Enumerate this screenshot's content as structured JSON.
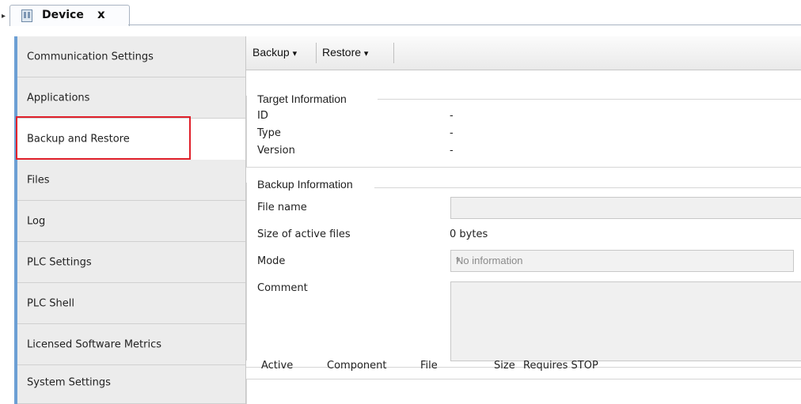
{
  "tab": {
    "title": "Device",
    "close": "x",
    "icon": "device-icon"
  },
  "sidebar": {
    "items": [
      {
        "label": "Communication Settings"
      },
      {
        "label": "Applications"
      },
      {
        "label": "Backup and Restore",
        "selected": true
      },
      {
        "label": "Files"
      },
      {
        "label": "Log"
      },
      {
        "label": "PLC Settings"
      },
      {
        "label": "PLC Shell"
      },
      {
        "label": "Licensed Software Metrics"
      },
      {
        "label": "System Settings"
      }
    ]
  },
  "toolbar": {
    "backup_label": "Backup",
    "restore_label": "Restore",
    "dropdown_glyph": "▾"
  },
  "target_info": {
    "title": "Target Information",
    "id_label": "ID",
    "id_value": "-",
    "type_label": "Type",
    "type_value": "-",
    "version_label": "Version",
    "version_value": "-"
  },
  "backup_info": {
    "title": "Backup Information",
    "file_name_label": "File name",
    "file_name_value": "",
    "size_label": "Size of active files",
    "size_value": "0 bytes",
    "mode_label": "Mode",
    "mode_value": "No information",
    "comment_label": "Comment",
    "comment_value": ""
  },
  "table": {
    "columns": [
      "Active",
      "Component",
      "File",
      "Size",
      "Requires STOP"
    ]
  },
  "colors": {
    "sidebar_accent": "#6c9fd4",
    "selection_outline": "#e0202a"
  }
}
